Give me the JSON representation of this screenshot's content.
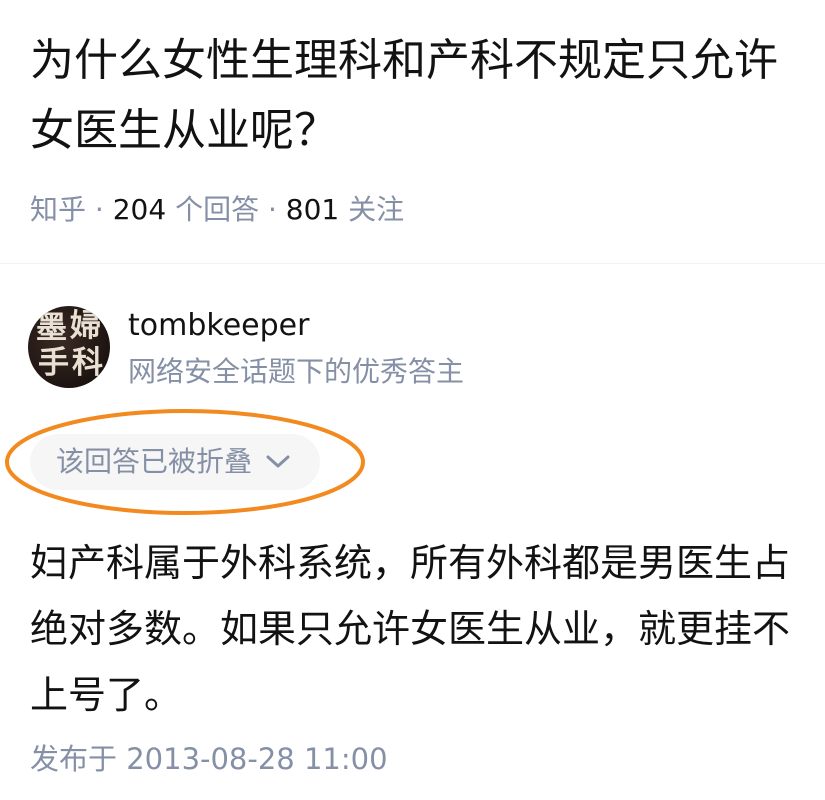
{
  "question": {
    "title": "为什么女性生理科和产科不规定只允许女医生从业呢？"
  },
  "meta": {
    "site": "知乎",
    "separator": " · ",
    "answers_count": "204",
    "answers_label": " 个回答",
    "followers_count": "801",
    "followers_label": " 关注"
  },
  "author": {
    "name": "tombkeeper",
    "badge": "网络安全话题下的优秀答主",
    "avatar_text": [
      "墨",
      "婦",
      "手",
      "科"
    ]
  },
  "answer": {
    "collapsed_label": "该回答已被折叠",
    "body": "妇产科属于外科系统，所有外科都是男医生占绝对多数。如果只允许女医生从业，就更挂不上号了。",
    "published": "发布于 2013-08-28 11:00"
  },
  "icons": {
    "collapse": "chevron-down-icon"
  },
  "colors": {
    "text": "#121212",
    "muted": "#8590a6",
    "pill_bg": "#f6f6f6",
    "annotation": "#f28a1f"
  }
}
